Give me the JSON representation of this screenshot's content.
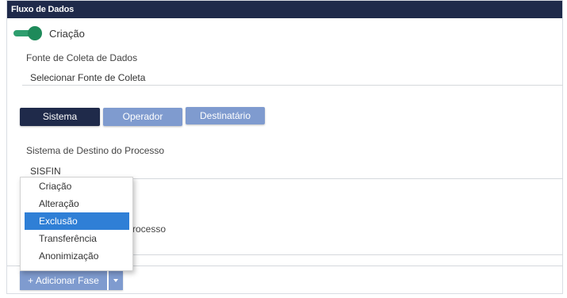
{
  "header": {
    "title": "Fluxo de Dados"
  },
  "phase_toggle": {
    "label": "Criação",
    "on": true,
    "color": "#2e9e6e"
  },
  "collection": {
    "label": "Fonte de Coleta de Dados",
    "value": "Selecionar Fonte de Coleta"
  },
  "tabs": [
    {
      "label": "Sistema",
      "active": true
    },
    {
      "label": "Operador",
      "active": false
    },
    {
      "label": "Destinatário",
      "active": false
    }
  ],
  "destination_system": {
    "label": "Sistema de Destino do Processo",
    "value": "SISFIN"
  },
  "hidden_field": {
    "label_partial": "rocesso"
  },
  "phase_menu": {
    "items": [
      "Criação",
      "Alteração",
      "Exclusão",
      "Transferência",
      "Anonimização"
    ],
    "highlighted": "Exclusão"
  },
  "add_phase_button": {
    "label": "+ Adicionar Fase"
  },
  "colors": {
    "header": "#1f2a4a",
    "tab_active": "#1f2a4a",
    "tab_inactive": "#7f9bcf",
    "highlight": "#2f7fd6"
  }
}
